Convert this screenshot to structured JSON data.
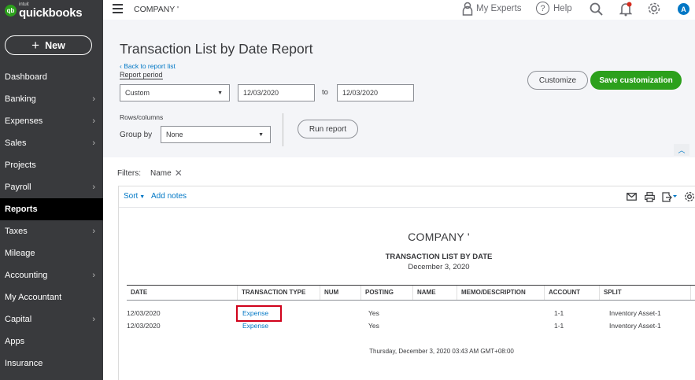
{
  "brand": {
    "intuit": "intuit",
    "name": "quickbooks",
    "mark": "qb"
  },
  "sidebar": {
    "new_label": "New",
    "items": [
      {
        "label": "Dashboard",
        "chevron": false,
        "active": false
      },
      {
        "label": "Banking",
        "chevron": true,
        "active": false
      },
      {
        "label": "Expenses",
        "chevron": true,
        "active": false
      },
      {
        "label": "Sales",
        "chevron": true,
        "active": false
      },
      {
        "label": "Projects",
        "chevron": false,
        "active": false
      },
      {
        "label": "Payroll",
        "chevron": true,
        "active": false
      },
      {
        "label": "Reports",
        "chevron": false,
        "active": true
      },
      {
        "label": "Taxes",
        "chevron": true,
        "active": false
      },
      {
        "label": "Mileage",
        "chevron": false,
        "active": false
      },
      {
        "label": "Accounting",
        "chevron": true,
        "active": false
      },
      {
        "label": "My Accountant",
        "chevron": false,
        "active": false
      },
      {
        "label": "Capital",
        "chevron": true,
        "active": false
      },
      {
        "label": "Apps",
        "chevron": false,
        "active": false
      },
      {
        "label": "Insurance",
        "chevron": false,
        "active": false
      }
    ]
  },
  "topbar": {
    "company": "COMPANY '",
    "my_experts": "My Experts",
    "help": "Help",
    "avatar_initial": "A"
  },
  "header": {
    "title": "Transaction List by Date Report",
    "back_link": "Back to report list",
    "report_period_label": "Report period",
    "period_value": "Custom",
    "date_from": "12/03/2020",
    "to_label": "to",
    "date_to": "12/03/2020",
    "rows_columns_label": "Rows/columns",
    "group_by_label": "Group by",
    "group_by_value": "None",
    "run_report": "Run report",
    "customize": "Customize",
    "save_customization": "Save customization"
  },
  "filters": {
    "label": "Filters:",
    "chip": "Name"
  },
  "toolbar": {
    "sort": "Sort",
    "add_notes": "Add notes"
  },
  "report": {
    "company": "COMPANY '",
    "title": "TRANSACTION LIST BY DATE",
    "date": "December 3, 2020",
    "columns": [
      "DATE",
      "TRANSACTION TYPE",
      "NUM",
      "POSTING",
      "NAME",
      "MEMO/DESCRIPTION",
      "ACCOUNT",
      "SPLIT"
    ],
    "rows": [
      {
        "date": "12/03/2020",
        "type": "Expense",
        "num": "",
        "posting": "Yes",
        "name": "",
        "memo": "",
        "account": "1-1",
        "split": "Inventory Asset-1"
      },
      {
        "date": "12/03/2020",
        "type": "Expense",
        "num": "",
        "posting": "Yes",
        "name": "",
        "memo": "",
        "account": "1-1",
        "split": "Inventory Asset-1"
      }
    ],
    "timestamp": "Thursday, December 3, 2020  03:43 AM GMT+08:00"
  },
  "colors": {
    "sidebar_bg": "#393a3d",
    "accent_green": "#2ca01c",
    "link_blue": "#0077c5",
    "highlight_red": "#d0021b"
  }
}
